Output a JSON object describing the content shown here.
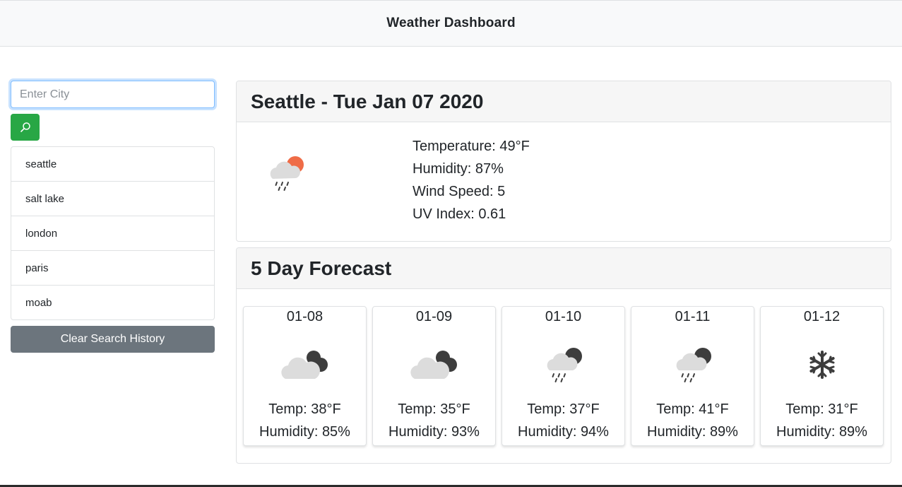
{
  "header": {
    "title": "Weather Dashboard"
  },
  "search": {
    "placeholder": "Enter City",
    "value": "",
    "button_icon": "search-icon"
  },
  "history": {
    "items": [
      {
        "label": "seattle"
      },
      {
        "label": "salt lake"
      },
      {
        "label": "london"
      },
      {
        "label": "paris"
      },
      {
        "label": "moab"
      }
    ],
    "clear_label": "Clear Search History"
  },
  "current": {
    "heading": "Seattle - Tue Jan 07 2020",
    "icon": "rain-sun-icon",
    "temperature": "Temperature: 49°F",
    "humidity": "Humidity: 87%",
    "wind": "Wind Speed: 5",
    "uv": "UV Index: 0.61"
  },
  "forecast": {
    "heading": "5 Day Forecast",
    "days": [
      {
        "date": "01-08",
        "icon": "cloudy-night-icon",
        "temp": "Temp: 38°F",
        "humidity": "Humidity: 85%"
      },
      {
        "date": "01-09",
        "icon": "cloudy-night-icon",
        "temp": "Temp: 35°F",
        "humidity": "Humidity: 93%"
      },
      {
        "date": "01-10",
        "icon": "rain-night-icon",
        "temp": "Temp: 37°F",
        "humidity": "Humidity: 94%"
      },
      {
        "date": "01-11",
        "icon": "rain-night-icon",
        "temp": "Temp: 41°F",
        "humidity": "Humidity: 89%"
      },
      {
        "date": "01-12",
        "icon": "snow-icon",
        "temp": "Temp: 31°F",
        "humidity": "Humidity: 89%"
      }
    ]
  },
  "colors": {
    "search_button": "#28a745",
    "clear_button": "#6c757d",
    "sun": "#ef6c47",
    "cloud": "#dcdcdc",
    "night": "#3d3d3d"
  }
}
